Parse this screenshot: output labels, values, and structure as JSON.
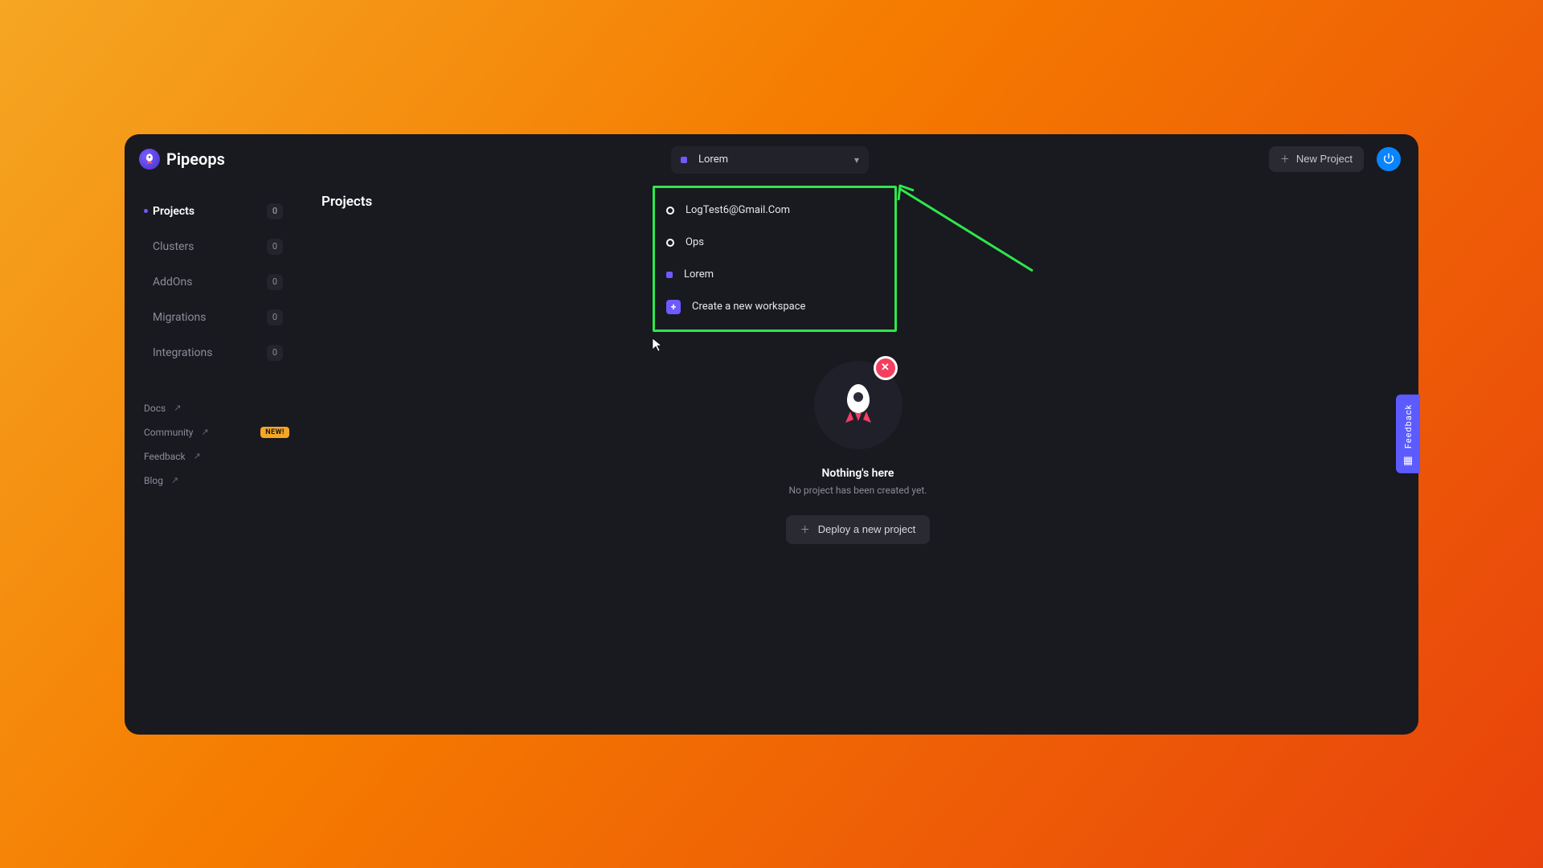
{
  "brand": {
    "name": "Pipeops"
  },
  "workspace": {
    "selected": "Lorem",
    "options": [
      "LogTest6@Gmail.Com",
      "Ops",
      "Lorem"
    ],
    "create_label": "Create a new workspace"
  },
  "header": {
    "new_project_label": "New Project"
  },
  "sidebar": {
    "nav": [
      {
        "label": "Projects",
        "count": "0",
        "active": true
      },
      {
        "label": "Clusters",
        "count": "0",
        "active": false
      },
      {
        "label": "AddOns",
        "count": "0",
        "active": false
      },
      {
        "label": "Migrations",
        "count": "0",
        "active": false
      },
      {
        "label": "Integrations",
        "count": "0",
        "active": false
      }
    ],
    "links": {
      "docs": "Docs",
      "community": "Community",
      "community_badge": "NEW!",
      "feedback": "Feedback",
      "blog": "Blog"
    }
  },
  "page": {
    "title": "Projects"
  },
  "empty": {
    "title": "Nothing's here",
    "subtitle": "No project has been created yet.",
    "cta": "Deploy a new project"
  },
  "feedback_tab": "Feedback",
  "annotation": {
    "highlight_color": "#2ee84b"
  }
}
